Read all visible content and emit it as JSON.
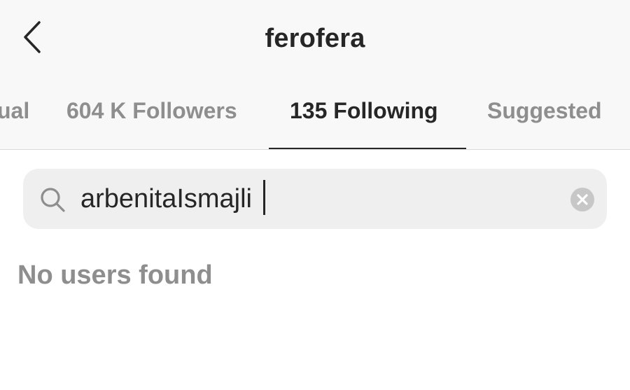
{
  "header": {
    "title": "ferofera",
    "back_icon": "chevron-left-icon"
  },
  "tabs": [
    {
      "label": "ual",
      "active": false
    },
    {
      "label": "604 K Followers",
      "active": false
    },
    {
      "label": "135 Following",
      "active": true
    },
    {
      "label": "Suggested",
      "active": false
    }
  ],
  "search": {
    "value": "arbenitaIsmajli",
    "icon": "search-icon",
    "clear_icon": "clear-circle-icon"
  },
  "results": {
    "empty_message": "No users found"
  },
  "colors": {
    "header_bg": "#f8f8f8",
    "text_primary": "#262626",
    "text_secondary": "#8e8e8e",
    "search_bg": "#efefef",
    "divider": "#dbdbdb"
  }
}
